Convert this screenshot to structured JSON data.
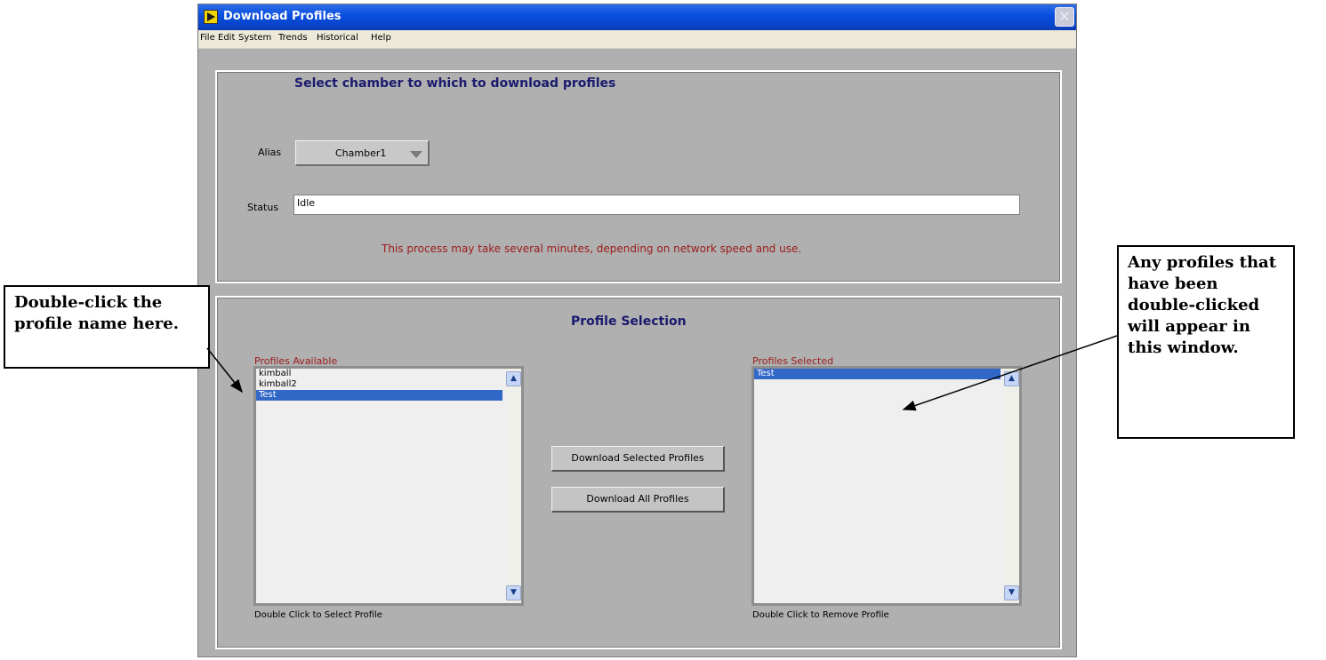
{
  "window": {
    "title": "Download Profiles",
    "close_glyph": "✕"
  },
  "menubar": {
    "items": [
      "File",
      "Edit",
      "System",
      "Trends",
      "Historical",
      "Help"
    ]
  },
  "chamber_panel": {
    "heading": "Select chamber to which to download profiles",
    "alias_label": "Alias",
    "alias_value": "Chamber1",
    "status_label": "Status",
    "status_value": "Idle",
    "warning": "This process may take several minutes, depending on network speed and use."
  },
  "profile_panel": {
    "heading": "Profile Selection",
    "available_caption": "Profiles Available",
    "available_items": [
      "kimball",
      "kimball2",
      "Test"
    ],
    "available_selected": "Test",
    "available_hint": "Double Click to Select Profile",
    "selected_caption": "Profiles Selected",
    "selected_items": [
      "Test"
    ],
    "selected_hint": "Double Click to Remove Profile",
    "download_selected_label": "Download Selected Profiles",
    "download_all_label": "Download All Profiles"
  },
  "callouts": {
    "left": "Double-click the profile name here.",
    "right": "Any profiles that have been double-clicked will appear in this window."
  },
  "icons": {
    "app": "labview-app-icon",
    "close": "close-icon",
    "dropdown": "triangle-down-icon",
    "scroll_up": "chevron-up-icon",
    "scroll_down": "chevron-down-icon",
    "arrow": "pointer-arrow-icon"
  },
  "colors": {
    "titlebar": "#0a4fe0",
    "heading": "#1a1a6e",
    "warning": "#9c1a1a",
    "selection": "#3168c8",
    "panel_bg": "#b0b0b0"
  }
}
